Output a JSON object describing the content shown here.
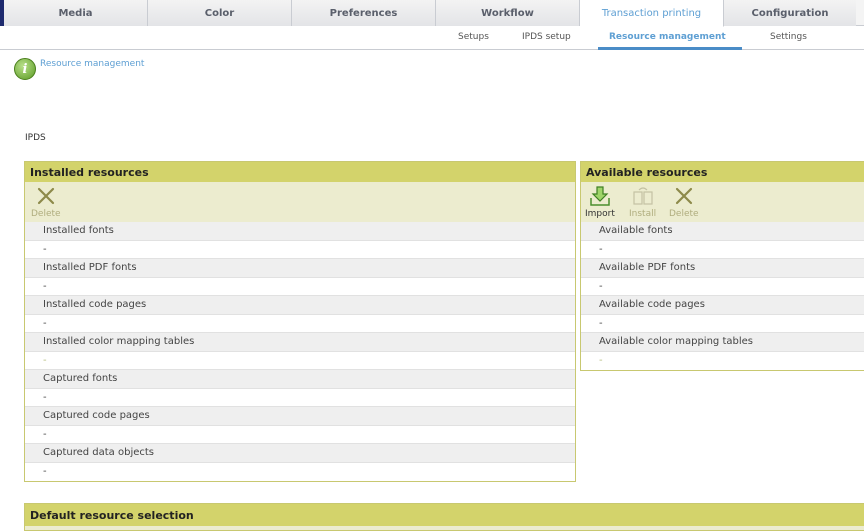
{
  "tabs": [
    {
      "label": "Media"
    },
    {
      "label": "Color"
    },
    {
      "label": "Preferences"
    },
    {
      "label": "Workflow"
    },
    {
      "label": "Transaction printing"
    },
    {
      "label": "Configuration"
    }
  ],
  "active_tab": "Transaction printing",
  "subtabs": [
    {
      "label": "Setups"
    },
    {
      "label": "IPDS setup"
    },
    {
      "label": "Resource management"
    },
    {
      "label": "Settings"
    }
  ],
  "active_subtab": "Resource management",
  "breadcrumb": {
    "text": "Resource management",
    "icon": "info-icon",
    "icon_glyph": "i"
  },
  "section_label": "IPDS",
  "installed": {
    "title": "Installed resources",
    "toolbar": {
      "delete_label": "Delete"
    },
    "rows": [
      {
        "label": "Installed fonts",
        "value": "-"
      },
      {
        "label": "Installed PDF fonts",
        "value": "-"
      },
      {
        "label": "Installed code pages",
        "value": "-"
      },
      {
        "label": "Installed color mapping tables",
        "value": "-"
      },
      {
        "label": "Captured fonts",
        "value": "-"
      },
      {
        "label": "Captured code pages",
        "value": "-"
      },
      {
        "label": "Captured data objects",
        "value": "-"
      }
    ]
  },
  "available": {
    "title": "Available resources",
    "toolbar": {
      "import_label": "Import",
      "install_label": "Install",
      "delete_label": "Delete"
    },
    "rows": [
      {
        "label": "Available fonts",
        "value": "-"
      },
      {
        "label": "Available PDF fonts",
        "value": "-"
      },
      {
        "label": "Available code pages",
        "value": "-"
      },
      {
        "label": "Available color mapping tables",
        "value": "-"
      }
    ]
  },
  "default_selection": {
    "title": "Default resource selection"
  },
  "colors": {
    "accent": "#5e9fd3",
    "panel_header": "#d3d36b",
    "toolbar_bg": "#ececcf",
    "nav_dark": "#1e2a6e"
  }
}
